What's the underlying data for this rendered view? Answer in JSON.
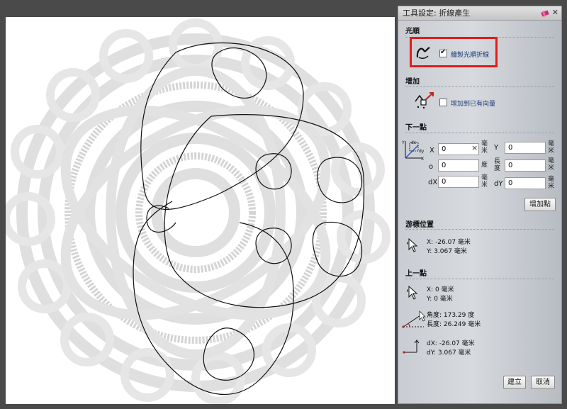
{
  "panel": {
    "title": "工具設定: 折線產生",
    "smooth": {
      "section_title": "光順",
      "checkbox_label": "繪製光順折線",
      "checked": true
    },
    "add": {
      "section_title": "增加",
      "checkbox_label": "增加到已有向量",
      "checked": false
    },
    "next_point": {
      "section_title": "下一點",
      "x_label": "X",
      "x_value": "0",
      "x_unit": "毫米",
      "y_label": "Y",
      "y_value": "0",
      "y_unit": "毫米",
      "angle_label": "o",
      "angle_value": "0",
      "angle_unit": "度",
      "length_label": "長度",
      "length_value": "0",
      "length_unit": "毫米",
      "dx_label": "dX",
      "dx_value": "0",
      "dx_unit": "毫米",
      "dy_label": "dY",
      "dy_value": "0",
      "dy_unit": "毫米",
      "add_point_button": "增加點"
    },
    "cursor_position": {
      "section_title": "游標位置",
      "x_text": "X: -26.07 毫米",
      "y_text": "Y: 3.067 毫米"
    },
    "previous_point": {
      "section_title": "上一點",
      "x_text": "X: 0 毫米",
      "y_text": "Y: 0 毫米",
      "angle_text": "角度: 173.29 度",
      "length_text": "長度: 26.249 毫米",
      "dx_text": "dX: -26.07 毫米",
      "dy_text": "dY: 3.067 毫米"
    },
    "buttons": {
      "create": "建立",
      "cancel": "取消"
    }
  },
  "colors": {
    "highlight": "#e21b1b",
    "workspace_bg": "#4a4a4a",
    "canvas_bg": "#ffffff",
    "knot_gray": "#dcdcdc"
  }
}
